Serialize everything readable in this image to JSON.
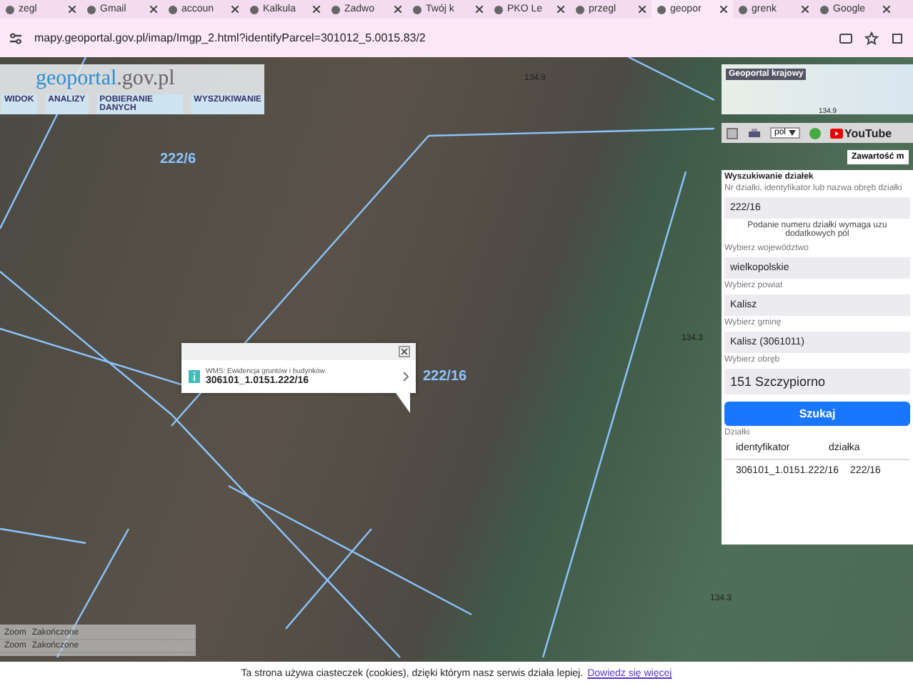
{
  "browser": {
    "tabs": [
      {
        "label": "zegl",
        "selected": false
      },
      {
        "label": "Gmail",
        "selected": false
      },
      {
        "label": "accoun",
        "selected": false
      },
      {
        "label": "Kalkula",
        "selected": false
      },
      {
        "label": "Zadwo",
        "selected": false
      },
      {
        "label": "Twój k",
        "selected": false
      },
      {
        "label": "PKO Le",
        "selected": false
      },
      {
        "label": "przegl",
        "selected": false
      },
      {
        "label": "geopor",
        "selected": true
      },
      {
        "label": "grenk",
        "selected": false
      },
      {
        "label": "Google",
        "selected": false
      }
    ],
    "url": "mapy.geoportal.gov.pl/imap/Imgp_2.html?identifyParcel=301012_5.0015.83/2"
  },
  "header": {
    "logo_main": "geoportal",
    "logo_suffix": ".gov.pl",
    "menu": [
      "WIDOK",
      "ANALIZY",
      "POBIERANIE DANYCH",
      "WYSZUKIWANIE"
    ]
  },
  "map": {
    "labels": [
      {
        "text": "222/6",
        "kind": "parcel"
      },
      {
        "text": "134.9",
        "kind": "height"
      },
      {
        "text": "222/16",
        "kind": "parcel"
      },
      {
        "text": "134.3",
        "kind": "height"
      },
      {
        "text": "134.3",
        "kind": "height"
      }
    ],
    "overview_title": "Geoportal krajowy",
    "overview_label": "134.9",
    "language": "pol",
    "youtube": "YouTube",
    "content_button": "Zawartość m",
    "popup": {
      "layer": "WMS: Ewidencja gruntów i budynków",
      "parcel_id": "306101_1.0151.222/16"
    },
    "status": [
      {
        "label": "Zoom",
        "value": "Zakończone"
      },
      {
        "label": "Zoom",
        "value": "Zakończone"
      }
    ]
  },
  "search": {
    "title": "Wyszukiwanie działek",
    "query_label": "Nr działki, identyfikator lub nazwa obręb działki",
    "query": "222/16",
    "hint": "Podanie numeru działki wymaga uzu dodatkowych pól",
    "fields": [
      {
        "label": "Wybierz województwo",
        "value": "wielkopolskie"
      },
      {
        "label": "Wybierz powiat",
        "value": "Kalisz"
      },
      {
        "label": "Wybierz gminę",
        "value": "Kalisz (3061011)"
      },
      {
        "label": "Wybierz obręb",
        "value": "151 Szczypiorno"
      }
    ],
    "button": "Szukaj",
    "results_title": "Działki",
    "columns": [
      "identyfikator",
      "działka"
    ],
    "rows": [
      [
        "306101_1.0151.222/16",
        "222/16"
      ]
    ]
  },
  "cookie": {
    "text": "Ta strona używa ciasteczek (cookies), dzięki którym nasz serwis działa lepiej.",
    "link": "Dowiedz się więcej"
  }
}
